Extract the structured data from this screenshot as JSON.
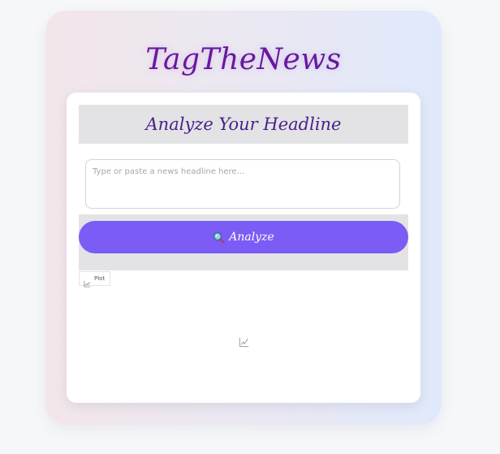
{
  "app": {
    "title": "TagTheNews"
  },
  "analyze_section": {
    "title": "Analyze Your Headline",
    "input": {
      "value": "",
      "placeholder": "Type or paste a news headline here..."
    },
    "button": {
      "icon": "magnifier-icon",
      "label": "Analyze",
      "color": "#7b5cf5"
    }
  },
  "plot_panel": {
    "tab_label": "Plot",
    "tab_icon": "chart-icon",
    "placeholder_icon": "chart-icon"
  },
  "colors": {
    "title": "#6a17a0",
    "section_title": "#4a1f8a",
    "header_background": "#e3e3e5"
  }
}
